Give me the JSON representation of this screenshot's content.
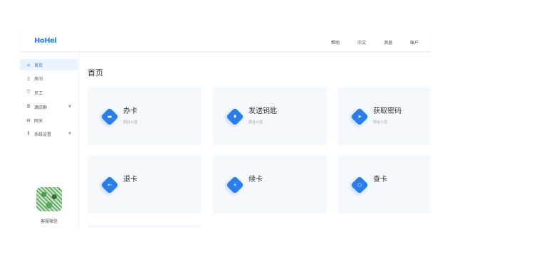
{
  "header": {
    "logo": "HoHel",
    "nav": [
      "帮助",
      "中文",
      "消息",
      "账户"
    ]
  },
  "sidebar": {
    "items": [
      {
        "icon": "home-icon",
        "glyph": "⌂",
        "label": "首页",
        "active": true
      },
      {
        "icon": "room-icon",
        "glyph": "▯",
        "label": "房间"
      },
      {
        "icon": "staff-icon",
        "glyph": "⛉",
        "label": "员工"
      },
      {
        "icon": "hotel-icon",
        "glyph": "⧉",
        "label": "酒店群",
        "expandable": true
      },
      {
        "icon": "gateway-icon",
        "glyph": "⊟",
        "label": "网关"
      },
      {
        "icon": "settings-icon",
        "glyph": "⫼",
        "label": "系统设置",
        "expandable": true
      }
    ],
    "qr_label": "客服微信"
  },
  "main": {
    "title": "首页",
    "cards": [
      {
        "title": "办卡",
        "subtitle": "前台入住",
        "icon": "card-icon",
        "glyph": "▬"
      },
      {
        "title": "发送钥匙",
        "subtitle": "前台入住",
        "icon": "key-icon",
        "glyph": "♦"
      },
      {
        "title": "获取密码",
        "subtitle": "前台入住",
        "icon": "send-icon",
        "glyph": "➤"
      },
      {
        "title": "退卡",
        "subtitle": "",
        "icon": "return-icon",
        "glyph": "←"
      },
      {
        "title": "续卡",
        "subtitle": "",
        "icon": "plus-icon",
        "glyph": "+"
      },
      {
        "title": "查卡",
        "subtitle": "",
        "icon": "search-icon",
        "glyph": "○"
      }
    ]
  },
  "colors": {
    "accent": "#2b7de9",
    "card_bg": "#f5f8fd",
    "active_bg": "#eaf3fe"
  }
}
